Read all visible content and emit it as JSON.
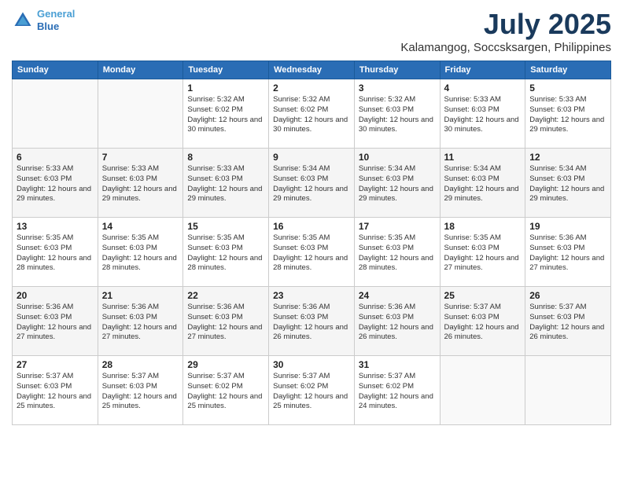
{
  "logo": {
    "line1": "General",
    "line2": "Blue"
  },
  "title": "July 2025",
  "subtitle": "Kalamangog, Soccsksargen, Philippines",
  "weekdays": [
    "Sunday",
    "Monday",
    "Tuesday",
    "Wednesday",
    "Thursday",
    "Friday",
    "Saturday"
  ],
  "weeks": [
    [
      {
        "day": "",
        "info": ""
      },
      {
        "day": "",
        "info": ""
      },
      {
        "day": "1",
        "info": "Sunrise: 5:32 AM\nSunset: 6:02 PM\nDaylight: 12 hours and 30 minutes."
      },
      {
        "day": "2",
        "info": "Sunrise: 5:32 AM\nSunset: 6:02 PM\nDaylight: 12 hours and 30 minutes."
      },
      {
        "day": "3",
        "info": "Sunrise: 5:32 AM\nSunset: 6:03 PM\nDaylight: 12 hours and 30 minutes."
      },
      {
        "day": "4",
        "info": "Sunrise: 5:33 AM\nSunset: 6:03 PM\nDaylight: 12 hours and 30 minutes."
      },
      {
        "day": "5",
        "info": "Sunrise: 5:33 AM\nSunset: 6:03 PM\nDaylight: 12 hours and 29 minutes."
      }
    ],
    [
      {
        "day": "6",
        "info": "Sunrise: 5:33 AM\nSunset: 6:03 PM\nDaylight: 12 hours and 29 minutes."
      },
      {
        "day": "7",
        "info": "Sunrise: 5:33 AM\nSunset: 6:03 PM\nDaylight: 12 hours and 29 minutes."
      },
      {
        "day": "8",
        "info": "Sunrise: 5:33 AM\nSunset: 6:03 PM\nDaylight: 12 hours and 29 minutes."
      },
      {
        "day": "9",
        "info": "Sunrise: 5:34 AM\nSunset: 6:03 PM\nDaylight: 12 hours and 29 minutes."
      },
      {
        "day": "10",
        "info": "Sunrise: 5:34 AM\nSunset: 6:03 PM\nDaylight: 12 hours and 29 minutes."
      },
      {
        "day": "11",
        "info": "Sunrise: 5:34 AM\nSunset: 6:03 PM\nDaylight: 12 hours and 29 minutes."
      },
      {
        "day": "12",
        "info": "Sunrise: 5:34 AM\nSunset: 6:03 PM\nDaylight: 12 hours and 29 minutes."
      }
    ],
    [
      {
        "day": "13",
        "info": "Sunrise: 5:35 AM\nSunset: 6:03 PM\nDaylight: 12 hours and 28 minutes."
      },
      {
        "day": "14",
        "info": "Sunrise: 5:35 AM\nSunset: 6:03 PM\nDaylight: 12 hours and 28 minutes."
      },
      {
        "day": "15",
        "info": "Sunrise: 5:35 AM\nSunset: 6:03 PM\nDaylight: 12 hours and 28 minutes."
      },
      {
        "day": "16",
        "info": "Sunrise: 5:35 AM\nSunset: 6:03 PM\nDaylight: 12 hours and 28 minutes."
      },
      {
        "day": "17",
        "info": "Sunrise: 5:35 AM\nSunset: 6:03 PM\nDaylight: 12 hours and 28 minutes."
      },
      {
        "day": "18",
        "info": "Sunrise: 5:35 AM\nSunset: 6:03 PM\nDaylight: 12 hours and 27 minutes."
      },
      {
        "day": "19",
        "info": "Sunrise: 5:36 AM\nSunset: 6:03 PM\nDaylight: 12 hours and 27 minutes."
      }
    ],
    [
      {
        "day": "20",
        "info": "Sunrise: 5:36 AM\nSunset: 6:03 PM\nDaylight: 12 hours and 27 minutes."
      },
      {
        "day": "21",
        "info": "Sunrise: 5:36 AM\nSunset: 6:03 PM\nDaylight: 12 hours and 27 minutes."
      },
      {
        "day": "22",
        "info": "Sunrise: 5:36 AM\nSunset: 6:03 PM\nDaylight: 12 hours and 27 minutes."
      },
      {
        "day": "23",
        "info": "Sunrise: 5:36 AM\nSunset: 6:03 PM\nDaylight: 12 hours and 26 minutes."
      },
      {
        "day": "24",
        "info": "Sunrise: 5:36 AM\nSunset: 6:03 PM\nDaylight: 12 hours and 26 minutes."
      },
      {
        "day": "25",
        "info": "Sunrise: 5:37 AM\nSunset: 6:03 PM\nDaylight: 12 hours and 26 minutes."
      },
      {
        "day": "26",
        "info": "Sunrise: 5:37 AM\nSunset: 6:03 PM\nDaylight: 12 hours and 26 minutes."
      }
    ],
    [
      {
        "day": "27",
        "info": "Sunrise: 5:37 AM\nSunset: 6:03 PM\nDaylight: 12 hours and 25 minutes."
      },
      {
        "day": "28",
        "info": "Sunrise: 5:37 AM\nSunset: 6:03 PM\nDaylight: 12 hours and 25 minutes."
      },
      {
        "day": "29",
        "info": "Sunrise: 5:37 AM\nSunset: 6:02 PM\nDaylight: 12 hours and 25 minutes."
      },
      {
        "day": "30",
        "info": "Sunrise: 5:37 AM\nSunset: 6:02 PM\nDaylight: 12 hours and 25 minutes."
      },
      {
        "day": "31",
        "info": "Sunrise: 5:37 AM\nSunset: 6:02 PM\nDaylight: 12 hours and 24 minutes."
      },
      {
        "day": "",
        "info": ""
      },
      {
        "day": "",
        "info": ""
      }
    ]
  ]
}
